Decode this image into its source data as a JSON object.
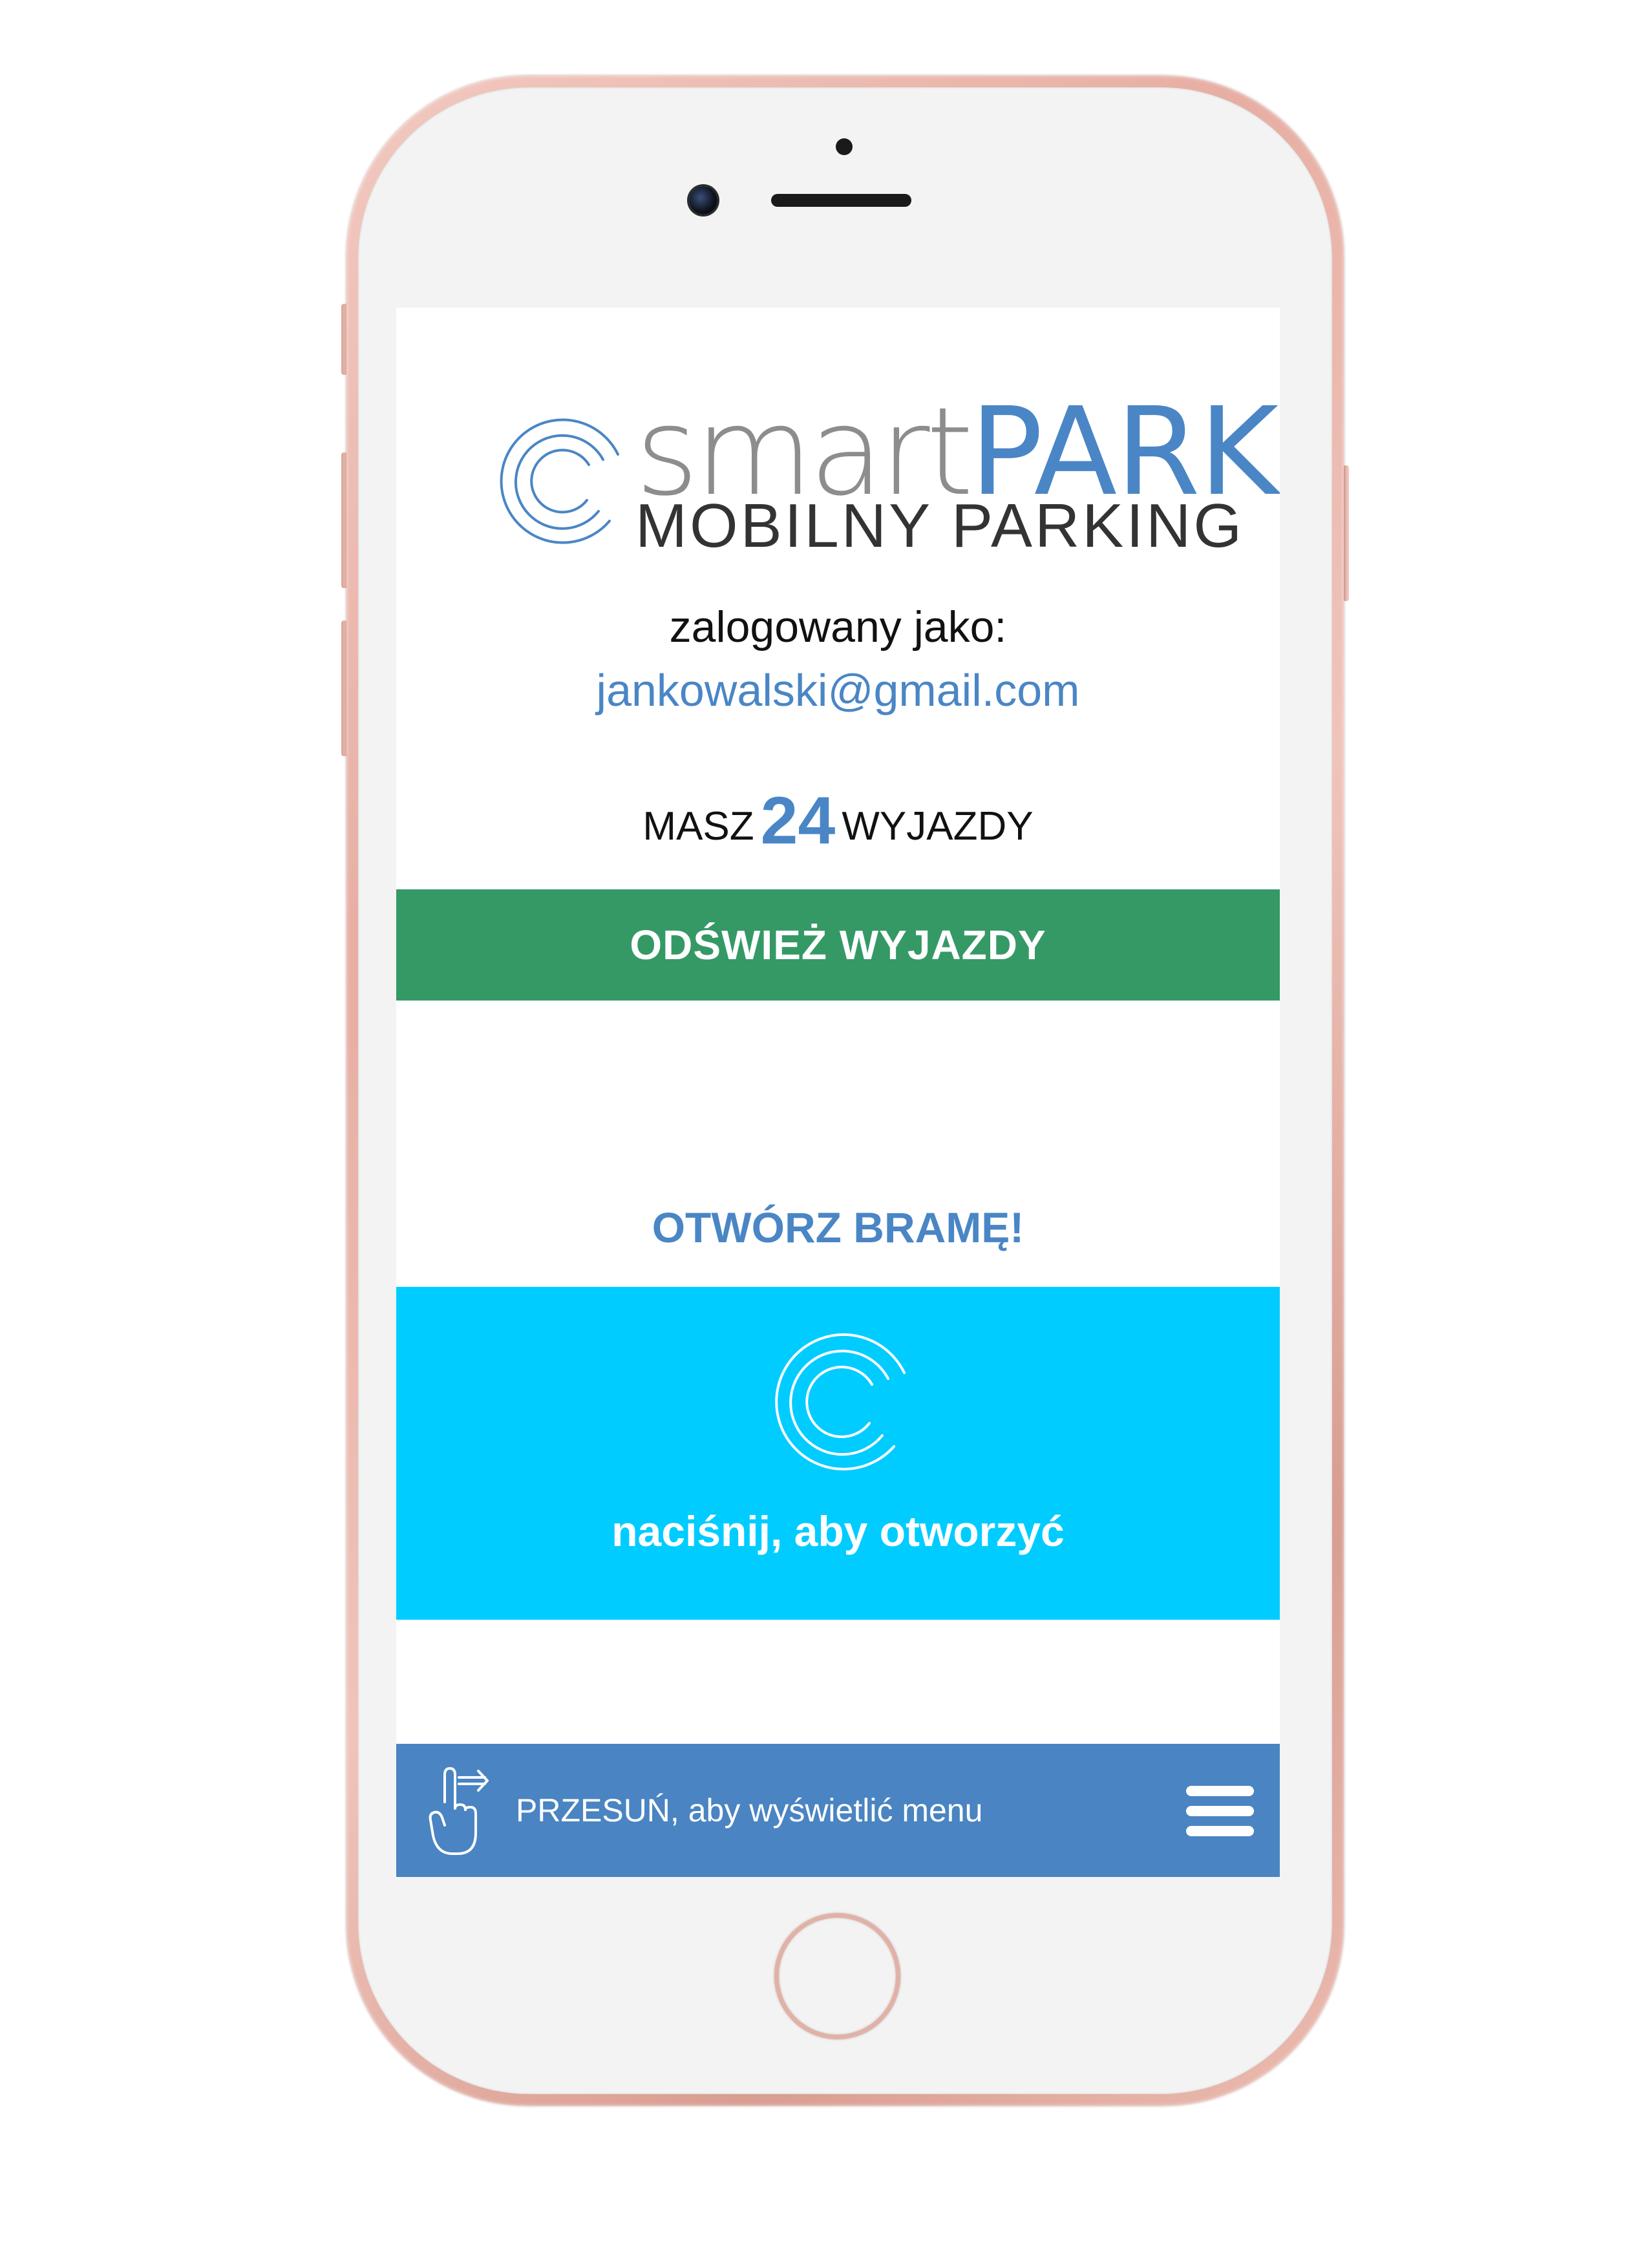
{
  "brand": {
    "word_light": "smart",
    "word_bold": "PARK",
    "subtitle": "MOBILNY PARKING",
    "color_primary": "#4a86c5",
    "color_grey": "#8d8d8d",
    "logo_icon": "smartpark-logo-icon"
  },
  "account": {
    "logged_label": "zalogowany jako:",
    "email": "jankowalski@gmail.com"
  },
  "trips": {
    "prefix": "MASZ",
    "count": "24",
    "suffix": "WYJAZDY"
  },
  "refresh_button": {
    "label": "ODŚWIEŻ WYJAZDY",
    "color": "#359966"
  },
  "gate": {
    "title": "OTWÓRZ BRAMĘ!",
    "hint": "naciśnij, aby otworzyć",
    "icon": "smartpark-gate-icon",
    "color": "#00ccff"
  },
  "bottom_bar": {
    "swipe_text": "PRZESUŃ, aby wyświetlić menu",
    "swipe_icon": "swipe-hand-icon",
    "menu_icon": "hamburger-menu-icon",
    "color": "#4a84c2"
  }
}
